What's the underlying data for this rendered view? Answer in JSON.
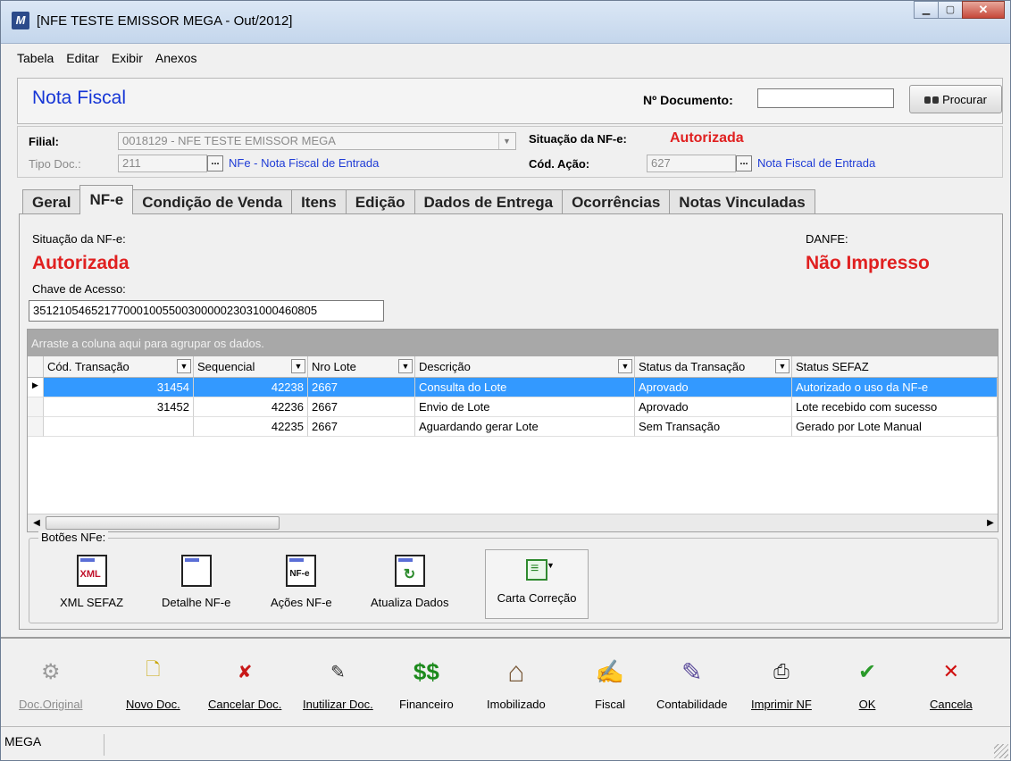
{
  "window": {
    "title": "[NFE TESTE EMISSOR MEGA - Out/2012]",
    "app_icon": "mega-app-icon",
    "controls": [
      "minimize",
      "maximize",
      "close"
    ]
  },
  "menu": {
    "items": [
      "Tabela",
      "Editar",
      "Exibir",
      "Anexos"
    ]
  },
  "header": {
    "title": "Nota Fiscal",
    "doc_number_label": "Nº Documento:",
    "doc_number_value": "",
    "search_button": "Procurar"
  },
  "info": {
    "filial_label": "Filial:",
    "filial_value": "0018129 - NFE TESTE EMISSOR MEGA",
    "situacao_label": "Situação da NF-e:",
    "situacao_value": "Autorizada",
    "tipo_doc_label": "Tipo Doc.:",
    "tipo_doc_value": "211",
    "tipo_doc_desc": "NFe - Nota Fiscal de Entrada",
    "cod_acao_label": "Cód. Ação:",
    "cod_acao_value": "627",
    "cod_acao_desc": "Nota Fiscal de Entrada",
    "ellipsis": "..."
  },
  "tabs": [
    "Geral",
    "NF-e",
    "Condição de Venda",
    "Itens",
    "Edição",
    "Dados de Entrega",
    "Ocorrências",
    "Notas Vinculadas"
  ],
  "nfe": {
    "situacao_label": "Situação da NF-e:",
    "situacao_value": "Autorizada",
    "danfe_label": "DANFE:",
    "danfe_value": "Não Impresso",
    "chave_label": "Chave de Acesso:",
    "chave_value": "35121054652177000100550030000023031000460805"
  },
  "grid": {
    "group_hint": "Arraste a coluna aqui para agrupar os dados.",
    "columns": [
      "Cód. Transação",
      "Sequencial",
      "Nro Lote",
      "Descrição",
      "Status da Transação",
      "Status SEFAZ"
    ],
    "rows": [
      {
        "cod": "31454",
        "seq": "42238",
        "lote": "2667",
        "desc": "Consulta do Lote",
        "status": "Aprovado",
        "sefaz": "Autorizado o uso da NF-e"
      },
      {
        "cod": "31452",
        "seq": "42236",
        "lote": "2667",
        "desc": "Envio de Lote",
        "status": "Aprovado",
        "sefaz": "Lote recebido com sucesso"
      },
      {
        "cod": "",
        "seq": "42235",
        "lote": "2667",
        "desc": "Aguardando gerar Lote",
        "status": "Sem Transação",
        "sefaz": "Gerado por Lote Manual"
      }
    ],
    "selected_row": 0
  },
  "nfe_buttons": {
    "title": "Botões NFe:",
    "items": [
      {
        "label": "XML SEFAZ",
        "icon_tag": "XML"
      },
      {
        "label": "Detalhe NF-e",
        "icon_tag": ""
      },
      {
        "label": "Ações NF-e",
        "icon_tag": "NF-e"
      },
      {
        "label": "Atualiza Dados",
        "icon_tag": "↻"
      },
      {
        "label": "Carta Correção",
        "icon_tag": "≡"
      }
    ]
  },
  "toolbar": {
    "items": [
      {
        "label": "Doc.Original",
        "icon": "gear-doc-icon",
        "glyph": "⚙",
        "disabled": true
      },
      {
        "label": "Novo Doc.",
        "icon": "new-doc-icon",
        "glyph": "🗋",
        "disabled": false
      },
      {
        "label": "Cancelar Doc.",
        "icon": "cancel-doc-icon",
        "glyph": "✘",
        "disabled": false
      },
      {
        "label": "Inutilizar Doc.",
        "icon": "invalidate-doc-icon",
        "glyph": "✎",
        "disabled": false
      },
      {
        "label": "Financeiro",
        "icon": "money-icon",
        "glyph": "$$",
        "disabled": false
      },
      {
        "label": "Imobilizado",
        "icon": "house-car-icon",
        "glyph": "⌂",
        "disabled": false
      },
      {
        "label": "Fiscal",
        "icon": "fiscal-icon",
        "glyph": "✍",
        "disabled": false
      },
      {
        "label": "Contabilidade",
        "icon": "accounting-icon",
        "glyph": "✎",
        "disabled": false
      },
      {
        "label": "Imprimir NF",
        "icon": "printer-icon",
        "glyph": "⎙",
        "disabled": false
      },
      {
        "label": "OK",
        "icon": "check-icon",
        "glyph": "✔",
        "disabled": false
      },
      {
        "label": "Cancela",
        "icon": "cancel-x-icon",
        "glyph": "✕",
        "disabled": false
      }
    ]
  },
  "status": {
    "text": "MEGA"
  },
  "colors": {
    "title_blue": "#1535d6",
    "status_red": "#e02020",
    "selection_blue": "#3399ff",
    "check_green": "#2a9a2a",
    "cancel_red": "#d01010",
    "money_green": "#1c8a1c"
  }
}
